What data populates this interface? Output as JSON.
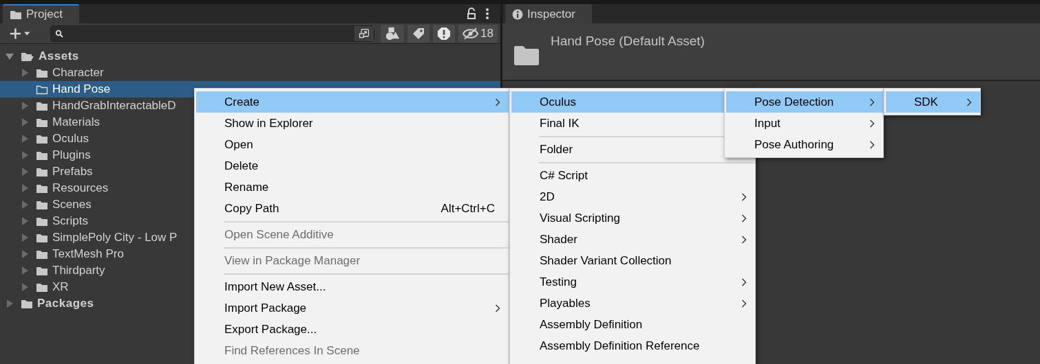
{
  "project_panel": {
    "tab": {
      "label": "Project"
    },
    "hidden_count": "18",
    "tree": [
      {
        "label": "Assets",
        "expanded": true,
        "selected": false,
        "has_children": true,
        "children": [
          {
            "label": "Character",
            "selected": false,
            "has_children": true
          },
          {
            "label": "Hand Pose",
            "selected": true,
            "has_children": false
          },
          {
            "label": "HandGrabInteractableD",
            "selected": false,
            "has_children": true
          },
          {
            "label": "Materials",
            "selected": false,
            "has_children": true
          },
          {
            "label": "Oculus",
            "selected": false,
            "has_children": true
          },
          {
            "label": "Plugins",
            "selected": false,
            "has_children": true
          },
          {
            "label": "Prefabs",
            "selected": false,
            "has_children": true
          },
          {
            "label": "Resources",
            "selected": false,
            "has_children": true
          },
          {
            "label": "Scenes",
            "selected": false,
            "has_children": true
          },
          {
            "label": "Scripts",
            "selected": false,
            "has_children": true
          },
          {
            "label": "SimplePoly City - Low P",
            "selected": false,
            "has_children": true
          },
          {
            "label": "TextMesh Pro",
            "selected": false,
            "has_children": true
          },
          {
            "label": "Thirdparty",
            "selected": false,
            "has_children": true
          },
          {
            "label": "XR",
            "selected": false,
            "has_children": true
          }
        ]
      },
      {
        "label": "Packages",
        "selected": false,
        "has_children": true
      }
    ]
  },
  "inspector": {
    "tab": {
      "label": "Inspector"
    },
    "title": "Hand Pose (Default Asset)"
  },
  "menus": [
    {
      "items": [
        {
          "kind": "item",
          "label": "Create",
          "submenu": true,
          "selected": true,
          "disabled": false
        },
        {
          "kind": "item",
          "label": "Show in Explorer",
          "submenu": false,
          "selected": false,
          "disabled": false
        },
        {
          "kind": "item",
          "label": "Open",
          "submenu": false,
          "selected": false,
          "disabled": false
        },
        {
          "kind": "item",
          "label": "Delete",
          "submenu": false,
          "selected": false,
          "disabled": false
        },
        {
          "kind": "item",
          "label": "Rename",
          "submenu": false,
          "selected": false,
          "disabled": false
        },
        {
          "kind": "item",
          "label": "Copy Path",
          "shortcut": "Alt+Ctrl+C",
          "submenu": false,
          "selected": false,
          "disabled": false
        },
        {
          "kind": "separator"
        },
        {
          "kind": "item",
          "label": "Open Scene Additive",
          "submenu": false,
          "selected": false,
          "disabled": true
        },
        {
          "kind": "separator"
        },
        {
          "kind": "item",
          "label": "View in Package Manager",
          "submenu": false,
          "selected": false,
          "disabled": true
        },
        {
          "kind": "separator"
        },
        {
          "kind": "item",
          "label": "Import New Asset...",
          "submenu": false,
          "selected": false,
          "disabled": false
        },
        {
          "kind": "item",
          "label": "Import Package",
          "submenu": true,
          "selected": false,
          "disabled": false
        },
        {
          "kind": "item",
          "label": "Export Package...",
          "submenu": false,
          "selected": false,
          "disabled": false
        },
        {
          "kind": "item",
          "label": "Find References In Scene",
          "submenu": false,
          "selected": false,
          "disabled": true
        }
      ]
    },
    {
      "items": [
        {
          "kind": "item",
          "label": "Oculus",
          "selected": true,
          "disabled": false
        },
        {
          "kind": "item",
          "label": "Final IK",
          "selected": false,
          "disabled": false
        },
        {
          "kind": "separator"
        },
        {
          "kind": "item",
          "label": "Folder",
          "submenu": false,
          "selected": false,
          "disabled": false
        },
        {
          "kind": "separator"
        },
        {
          "kind": "item",
          "label": "C# Script",
          "submenu": false,
          "selected": false,
          "disabled": false
        },
        {
          "kind": "item",
          "label": "2D",
          "submenu": true,
          "selected": false,
          "disabled": false
        },
        {
          "kind": "item",
          "label": "Visual Scripting",
          "submenu": true,
          "selected": false,
          "disabled": false
        },
        {
          "kind": "item",
          "label": "Shader",
          "submenu": true,
          "selected": false,
          "disabled": false
        },
        {
          "kind": "item",
          "label": "Shader Variant Collection",
          "submenu": false,
          "selected": false,
          "disabled": false
        },
        {
          "kind": "item",
          "label": "Testing",
          "submenu": true,
          "selected": false,
          "disabled": false
        },
        {
          "kind": "item",
          "label": "Playables",
          "submenu": true,
          "selected": false,
          "disabled": false
        },
        {
          "kind": "item",
          "label": "Assembly Definition",
          "submenu": false,
          "selected": false,
          "disabled": false
        },
        {
          "kind": "item",
          "label": "Assembly Definition Reference",
          "submenu": false,
          "selected": false,
          "disabled": false
        }
      ]
    },
    {
      "items": [
        {
          "kind": "item",
          "label": "Pose Detection",
          "submenu": true,
          "selected": true,
          "disabled": false
        },
        {
          "kind": "item",
          "label": "Input",
          "submenu": true,
          "selected": false,
          "disabled": false
        },
        {
          "kind": "item",
          "label": "Pose Authoring",
          "submenu": true,
          "selected": false,
          "disabled": false
        }
      ]
    },
    {
      "items": [
        {
          "kind": "item",
          "label": "SDK",
          "submenu": true,
          "selected": true,
          "disabled": false
        }
      ]
    }
  ]
}
